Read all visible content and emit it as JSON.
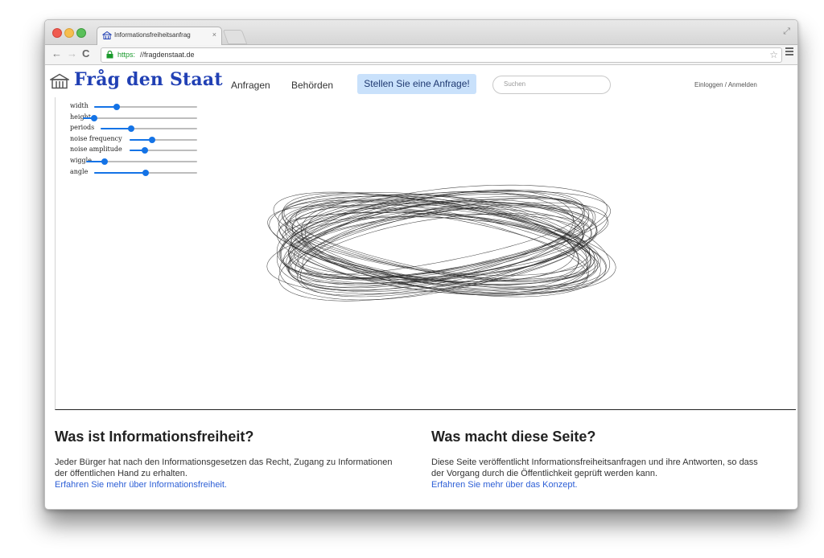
{
  "browser": {
    "tab_title": "Informationsfreiheitsanfrag",
    "tab_close": "×",
    "url_scheme": "https:",
    "url_rest": "//fragdenstaat.de",
    "nav_back": "←",
    "nav_forward": "→",
    "nav_reload": "C",
    "bookmark_star": "☆",
    "fullscreen_glyph": "⤢"
  },
  "site": {
    "logo": "Fråg den Staat",
    "nav": [
      "Anfragen",
      "Behörden"
    ],
    "cta": "Stellen Sie eine Anfrage!",
    "search_placeholder": "Suchen",
    "login": "Einloggen / Anmelden",
    "brand_color": "#2140b4",
    "cta_color": "#c9e1fb"
  },
  "controls": {
    "accent_color": "#1473e6",
    "sliders": [
      {
        "label": "width",
        "value": 0.22
      },
      {
        "label": "height",
        "value": 0.1
      },
      {
        "label": "periods",
        "value": 0.32
      },
      {
        "label": "noise frequency",
        "value": 0.33
      },
      {
        "label": "noise amplitude",
        "value": 0.23
      },
      {
        "label": "wiggle",
        "value": 0.17
      },
      {
        "label": "angle",
        "value": 0.5
      }
    ]
  },
  "info_left": {
    "title": "Was ist Informationsfreiheit?",
    "text": "Jeder Bürger hat nach den Informationsgesetzen das Recht, Zugang zu Informationen der öffentlichen Hand zu erhalten.",
    "link": "Erfahren Sie mehr über Informationsfreiheit."
  },
  "info_right": {
    "title": "Was macht diese Seite?",
    "text": "Diese Seite veröffentlicht Informationsfreiheitsanfragen und ihre Antworten, so dass der Vorgang durch die Öffentlichkeit geprüft werden kann.",
    "link": "Erfahren Sie mehr über das Konzept."
  }
}
